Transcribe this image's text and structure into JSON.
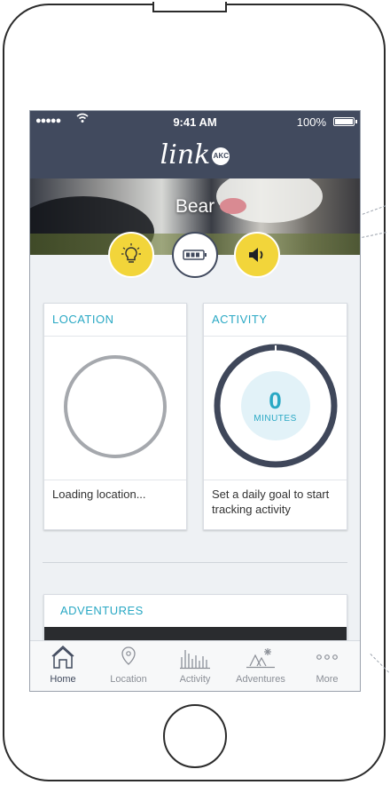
{
  "status_bar": {
    "signal": "●●●●●",
    "time": "9:41 AM",
    "battery": "100%"
  },
  "header": {
    "logo_text": "link",
    "logo_badge": "AKC"
  },
  "profile": {
    "dog_name": "Bear"
  },
  "quick_actions": {
    "light_icon": "lightbulb-icon",
    "battery_icon": "battery-icon",
    "sound_icon": "speaker-icon"
  },
  "location_card": {
    "title": "LOCATION",
    "status": "Loading location..."
  },
  "activity_card": {
    "title": "ACTIVITY",
    "minutes": "0",
    "minutes_label": "MINUTES",
    "message": "Set a daily goal to start tracking activity",
    "progress": 0
  },
  "adventures_card": {
    "title": "ADVENTURES"
  },
  "tabs": [
    {
      "label": "Home",
      "icon": "home-icon",
      "active": true
    },
    {
      "label": "Location",
      "icon": "location-pin-icon",
      "active": false
    },
    {
      "label": "Activity",
      "icon": "activity-bars-icon",
      "active": false
    },
    {
      "label": "Adventures",
      "icon": "adventures-icon",
      "active": false
    },
    {
      "label": "More",
      "icon": "more-icon",
      "active": false
    }
  ],
  "colors": {
    "header": "#414a5e",
    "accent": "#29a8c4",
    "yellow": "#f2d53a",
    "background": "#eef1f4"
  }
}
